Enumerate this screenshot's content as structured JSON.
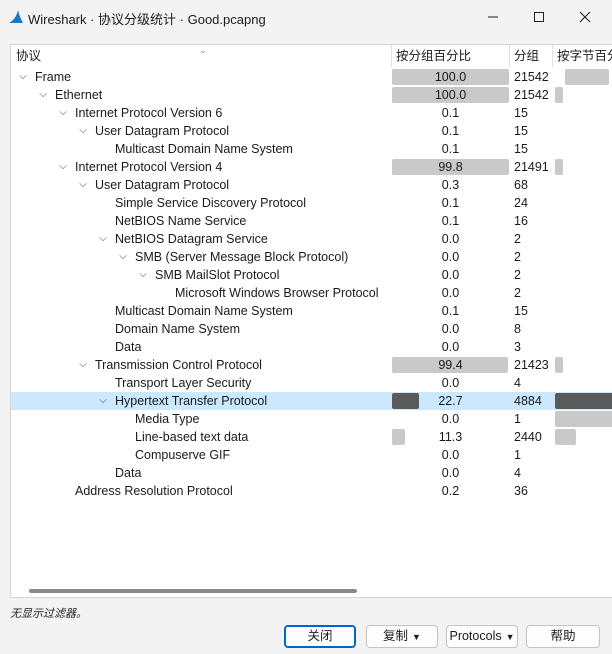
{
  "window": {
    "title": "Wireshark · 协议分级统计 · Good.pcapng",
    "colors": {
      "selected_row": "#cce8ff",
      "bar_light": "#c9c9c9",
      "bar_dark": "#5a5a5a",
      "default_border": "#0067c0"
    }
  },
  "columns": [
    "协议",
    "按分组百分比",
    "分组",
    "按字节百分"
  ],
  "rows": [
    {
      "name": "Frame",
      "indent": 0,
      "caret": "down",
      "pct": "100.0",
      "pct_value": 100.0,
      "packets": "21542",
      "pkt_frac": 0.0,
      "byte_frac": 1.0
    },
    {
      "name": "Ethernet",
      "indent": 1,
      "caret": "down",
      "pct": "100.0",
      "pct_value": 100.0,
      "packets": "21542",
      "pkt_frac": 0.12,
      "byte_frac": 0.0
    },
    {
      "name": "Internet Protocol Version 6",
      "indent": 2,
      "caret": "down",
      "pct": "0.1",
      "pct_value": 0.1,
      "packets": "15",
      "pkt_frac": 0,
      "byte_frac": 0
    },
    {
      "name": "User Datagram Protocol",
      "indent": 3,
      "caret": "down",
      "pct": "0.1",
      "pct_value": 0.1,
      "packets": "15",
      "pkt_frac": 0,
      "byte_frac": 0
    },
    {
      "name": "Multicast Domain Name System",
      "indent": 4,
      "caret": "",
      "pct": "0.1",
      "pct_value": 0.1,
      "packets": "15",
      "pkt_frac": 0,
      "byte_frac": 0
    },
    {
      "name": "Internet Protocol Version 4",
      "indent": 2,
      "caret": "down",
      "pct": "99.8",
      "pct_value": 99.8,
      "packets": "21491",
      "pkt_frac": 0.12,
      "byte_frac": 0
    },
    {
      "name": "User Datagram Protocol",
      "indent": 3,
      "caret": "down",
      "pct": "0.3",
      "pct_value": 0.3,
      "packets": "68",
      "pkt_frac": 0,
      "byte_frac": 0
    },
    {
      "name": "Simple Service Discovery Protocol",
      "indent": 4,
      "caret": "",
      "pct": "0.1",
      "pct_value": 0.1,
      "packets": "24",
      "pkt_frac": 0,
      "byte_frac": 0
    },
    {
      "name": "NetBIOS Name Service",
      "indent": 4,
      "caret": "",
      "pct": "0.1",
      "pct_value": 0.1,
      "packets": "16",
      "pkt_frac": 0,
      "byte_frac": 0
    },
    {
      "name": "NetBIOS Datagram Service",
      "indent": 4,
      "caret": "down",
      "pct": "0.0",
      "pct_value": 0.0,
      "packets": "2",
      "pkt_frac": 0,
      "byte_frac": 0
    },
    {
      "name": "SMB (Server Message Block Protocol)",
      "indent": 5,
      "caret": "down",
      "pct": "0.0",
      "pct_value": 0.0,
      "packets": "2",
      "pkt_frac": 0,
      "byte_frac": 0
    },
    {
      "name": "SMB MailSlot Protocol",
      "indent": 6,
      "caret": "down",
      "pct": "0.0",
      "pct_value": 0.0,
      "packets": "2",
      "pkt_frac": 0,
      "byte_frac": 0
    },
    {
      "name": "Microsoft Windows Browser Protocol",
      "indent": 7,
      "caret": "",
      "pct": "0.0",
      "pct_value": 0.0,
      "packets": "2",
      "pkt_frac": 0,
      "byte_frac": 0
    },
    {
      "name": "Multicast Domain Name System",
      "indent": 4,
      "caret": "",
      "pct": "0.1",
      "pct_value": 0.1,
      "packets": "15",
      "pkt_frac": 0,
      "byte_frac": 0
    },
    {
      "name": "Domain Name System",
      "indent": 4,
      "caret": "",
      "pct": "0.0",
      "pct_value": 0.0,
      "packets": "8",
      "pkt_frac": 0,
      "byte_frac": 0
    },
    {
      "name": "Data",
      "indent": 4,
      "caret": "",
      "pct": "0.0",
      "pct_value": 0.0,
      "packets": "3",
      "pkt_frac": 0,
      "byte_frac": 0
    },
    {
      "name": "Transmission Control Protocol",
      "indent": 3,
      "caret": "down",
      "pct": "99.4",
      "pct_value": 99.4,
      "packets": "21423",
      "pkt_frac": 0.12,
      "byte_frac": 0
    },
    {
      "name": "Transport Layer Security",
      "indent": 4,
      "caret": "",
      "pct": "0.0",
      "pct_value": 0.0,
      "packets": "4",
      "pkt_frac": 0,
      "byte_frac": 0
    },
    {
      "name": "Hypertext Transfer Protocol",
      "indent": 4,
      "caret": "down",
      "pct": "22.7",
      "pct_value": 22.7,
      "packets": "4884",
      "pkt_frac": 0,
      "byte_frac": 1.0,
      "selected": true,
      "dark": true
    },
    {
      "name": "Media Type",
      "indent": 5,
      "caret": "",
      "pct": "0.0",
      "pct_value": 0.0,
      "packets": "1",
      "pkt_frac": 0,
      "byte_frac": 1.0
    },
    {
      "name": "Line-based text data",
      "indent": 5,
      "caret": "",
      "pct": "11.3",
      "pct_value": 11.3,
      "packets": "2440",
      "pkt_frac": 0,
      "byte_frac": 0.35
    },
    {
      "name": "Compuserve GIF",
      "indent": 5,
      "caret": "",
      "pct": "0.0",
      "pct_value": 0.0,
      "packets": "1",
      "pkt_frac": 0,
      "byte_frac": 0
    },
    {
      "name": "Data",
      "indent": 4,
      "caret": "",
      "pct": "0.0",
      "pct_value": 0.0,
      "packets": "4",
      "pkt_frac": 0,
      "byte_frac": 0
    },
    {
      "name": "Address Resolution Protocol",
      "indent": 2,
      "caret": "",
      "pct": "0.2",
      "pct_value": 0.2,
      "packets": "36",
      "pkt_frac": 0,
      "byte_frac": 0
    }
  ],
  "status": {
    "filter_text": "无显示过滤器。"
  },
  "buttons": {
    "close": "关闭",
    "copy": "复制",
    "protocols": "Protocols",
    "help": "帮助"
  }
}
